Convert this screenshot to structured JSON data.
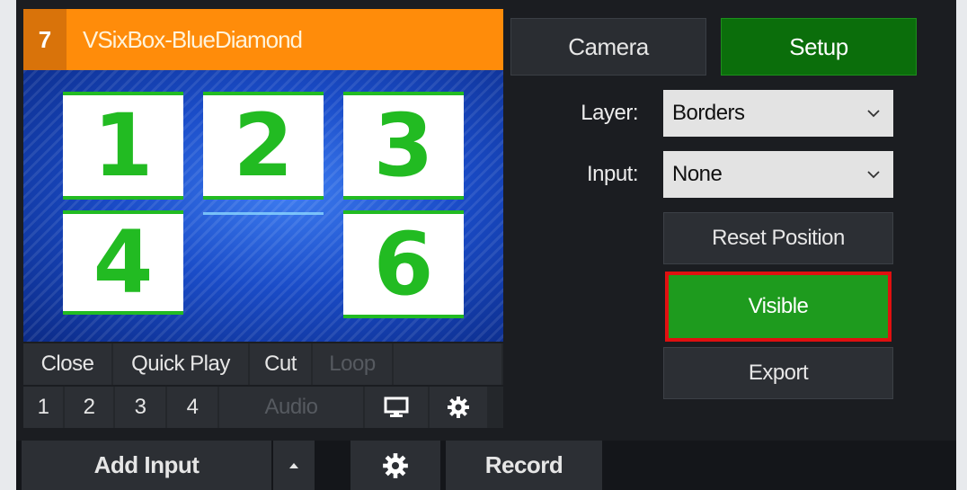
{
  "card": {
    "number": "7",
    "title": "VSixBox-BlueDiamond",
    "tiles": [
      "1",
      "2",
      "3",
      "4",
      "6"
    ],
    "row1": {
      "close": "Close",
      "quick_play": "Quick Play",
      "cut": "Cut",
      "loop": "Loop"
    },
    "row2": {
      "one": "1",
      "two": "2",
      "three": "3",
      "four": "4",
      "audio": "Audio",
      "monitor_icon": "monitor-icon",
      "settings_icon": "gear-icon"
    }
  },
  "tabs": {
    "camera": "Camera",
    "setup": "Setup"
  },
  "setup": {
    "layer_label": "Layer:",
    "layer_value": "Borders",
    "input_label": "Input:",
    "input_value": "None",
    "reset_position": "Reset Position",
    "visible": "Visible",
    "export": "Export"
  },
  "bottom": {
    "add_input": "Add Input",
    "add_input_menu_icon": "caret-up-icon",
    "settings_icon": "gear-icon",
    "record": "Record"
  },
  "colors": {
    "header_orange": "#ff8c0a",
    "setup_green": "#0b6e0b",
    "visible_green": "#1e9b1e",
    "highlight_red": "#e01010",
    "tile_green": "#22bb22"
  }
}
